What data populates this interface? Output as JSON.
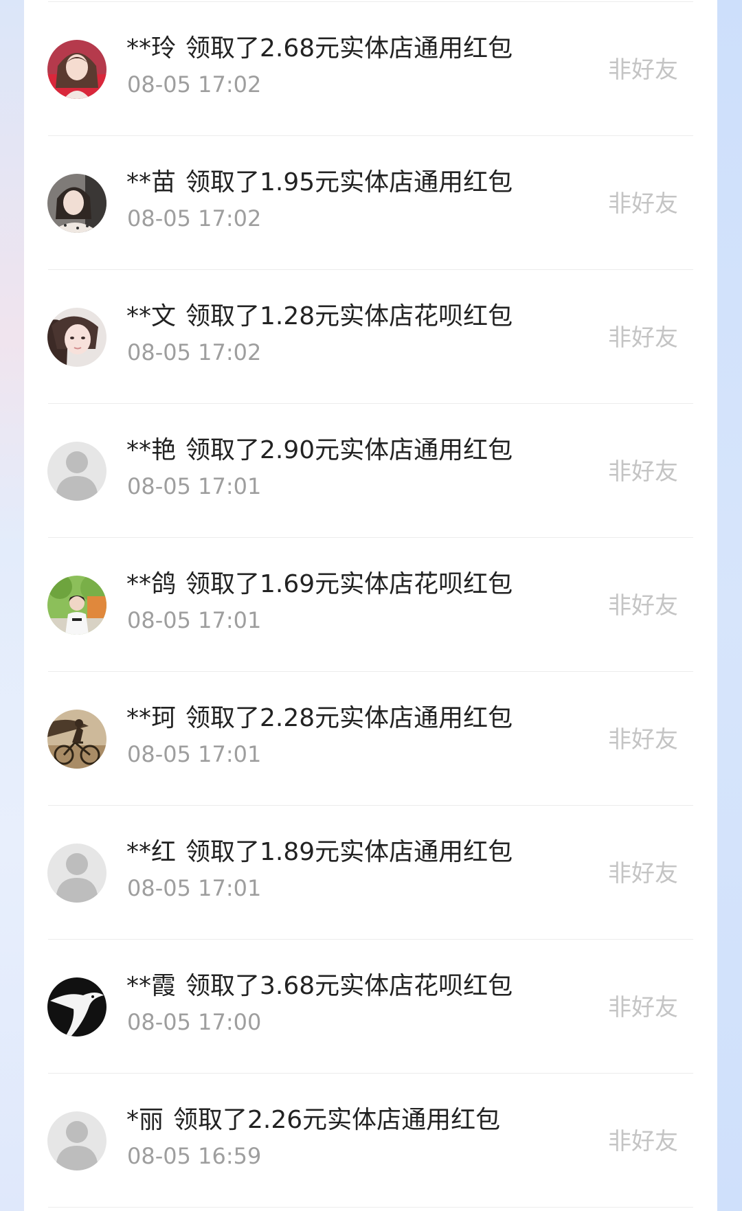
{
  "records": [
    {
      "name": "**玲",
      "action": "领取了2.68元实体店通用红包",
      "time": "08-05 17:02",
      "status": "非好友",
      "avatar_icon": "photo-avatar-girl-red-icon"
    },
    {
      "name": "**苗",
      "action": "领取了1.95元实体店通用红包",
      "time": "08-05 17:02",
      "status": "非好友",
      "avatar_icon": "photo-avatar-girl-icon"
    },
    {
      "name": "**文",
      "action": "领取了1.28元实体店花呗红包",
      "time": "08-05 17:02",
      "status": "非好友",
      "avatar_icon": "photo-avatar-girl-icon"
    },
    {
      "name": "**艳",
      "action": "领取了2.90元实体店通用红包",
      "time": "08-05 17:01",
      "status": "非好友",
      "avatar_icon": "default-avatar-icon"
    },
    {
      "name": "**鸽",
      "action": "领取了1.69元实体店花呗红包",
      "time": "08-05 17:01",
      "status": "非好友",
      "avatar_icon": "photo-avatar-outdoor-icon"
    },
    {
      "name": "**珂",
      "action": "领取了2.28元实体店通用红包",
      "time": "08-05 17:01",
      "status": "非好友",
      "avatar_icon": "photo-avatar-bicycle-icon"
    },
    {
      "name": "**红",
      "action": "领取了1.89元实体店通用红包",
      "time": "08-05 17:01",
      "status": "非好友",
      "avatar_icon": "default-avatar-icon"
    },
    {
      "name": "**霞",
      "action": "领取了3.68元实体店花呗红包",
      "time": "08-05 17:00",
      "status": "非好友",
      "avatar_icon": "photo-avatar-dark-icon"
    },
    {
      "name": "*丽",
      "action": "领取了2.26元实体店通用红包",
      "time": "08-05 16:59",
      "status": "非好友",
      "avatar_icon": "default-avatar-icon"
    }
  ],
  "colors": {
    "title_text": "#222222",
    "time_text": "#9e9e9e",
    "status_text": "#c4c4c4",
    "divider": "#ececec",
    "side_background": "#dfe8fb"
  }
}
